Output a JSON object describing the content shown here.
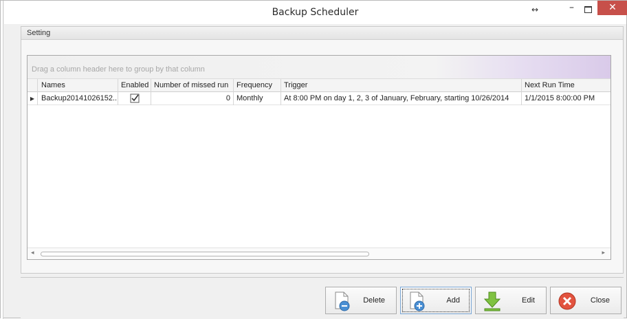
{
  "window": {
    "title": "Backup Scheduler",
    "controls": {
      "resize": "↔",
      "minimize": "–",
      "close": "✕"
    }
  },
  "group": {
    "title": "Setting"
  },
  "grid": {
    "group_panel_hint": "Drag a column header here to group by that column",
    "columns": [
      "Names",
      "Enabled",
      "Number of missed run",
      "Frequency",
      "Trigger",
      "Next Run Time"
    ],
    "rows": [
      {
        "indicator": "▶",
        "name": "Backup20141026152...",
        "enabled": true,
        "missed": "0",
        "frequency": "Monthly",
        "trigger": "At 8:00 PM on day 1, 2, 3 of January, February, starting 10/26/2014",
        "next_run": "1/1/2015 8:00:00 PM"
      }
    ],
    "scroll": {
      "left": "◂",
      "right": "▸"
    }
  },
  "buttons": {
    "delete": "Delete",
    "add": "Add",
    "edit": "Edit",
    "close": "Close"
  }
}
